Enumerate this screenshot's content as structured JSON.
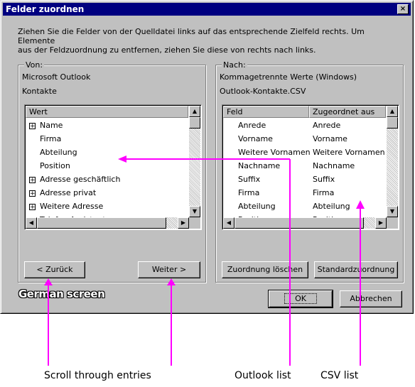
{
  "dialog": {
    "title": "Felder zuordnen",
    "close_glyph": "×",
    "instruction_line1": "Ziehen Sie die Felder von der Quelldatei links auf das entsprechende Zielfeld rechts. Um Elemente",
    "instruction_line2": "aus der Feldzuordnung zu entfernen, ziehen Sie diese von rechts nach links."
  },
  "from": {
    "legend": "Von:",
    "line1": "Microsoft Outlook",
    "line2": "Kontakte",
    "column": "Wert",
    "items": [
      {
        "label": "Name",
        "expandable": true
      },
      {
        "label": "Firma",
        "expandable": false
      },
      {
        "label": "Abteilung",
        "expandable": false
      },
      {
        "label": "Position",
        "expandable": false
      },
      {
        "label": "Adresse geschäftlich",
        "expandable": true
      },
      {
        "label": "Adresse privat",
        "expandable": true
      },
      {
        "label": "Weitere Adresse",
        "expandable": true
      }
    ],
    "partial_item": "Telefon Assistent",
    "back_button": "< Zurück",
    "next_button": "Weiter >"
  },
  "to": {
    "legend": "Nach:",
    "line1": "Kommagetrennte Werte (Windows)",
    "line2": "Outlook-Kontakte.CSV",
    "columns": [
      "Feld",
      "Zugeordnet aus"
    ],
    "rows": [
      [
        "Anrede",
        "Anrede"
      ],
      [
        "Vorname",
        "Vorname"
      ],
      [
        "Weitere Vornamen",
        "Weitere Vornamen"
      ],
      [
        "Nachname",
        "Nachname"
      ],
      [
        "Suffix",
        "Suffix"
      ],
      [
        "Firma",
        "Firma"
      ],
      [
        "Abteilung",
        "Abteilung"
      ]
    ],
    "partial_row": [
      "Position",
      "Position"
    ],
    "clear_button": "Zuordnung löschen",
    "default_button": "Standardzuordnung"
  },
  "footer": {
    "ok_button": "OK",
    "cancel_button": "Abbrechen"
  },
  "annotations": {
    "german_screen": "German screen",
    "scroll": "Scroll through entries",
    "outlook": "Outlook list",
    "csv": "CSV list",
    "arrow_color": "#ff00ff"
  },
  "glyphs": {
    "expand": "+",
    "arrow_up": "▲",
    "arrow_down": "▼",
    "arrow_left": "◀",
    "arrow_right": "▶"
  }
}
